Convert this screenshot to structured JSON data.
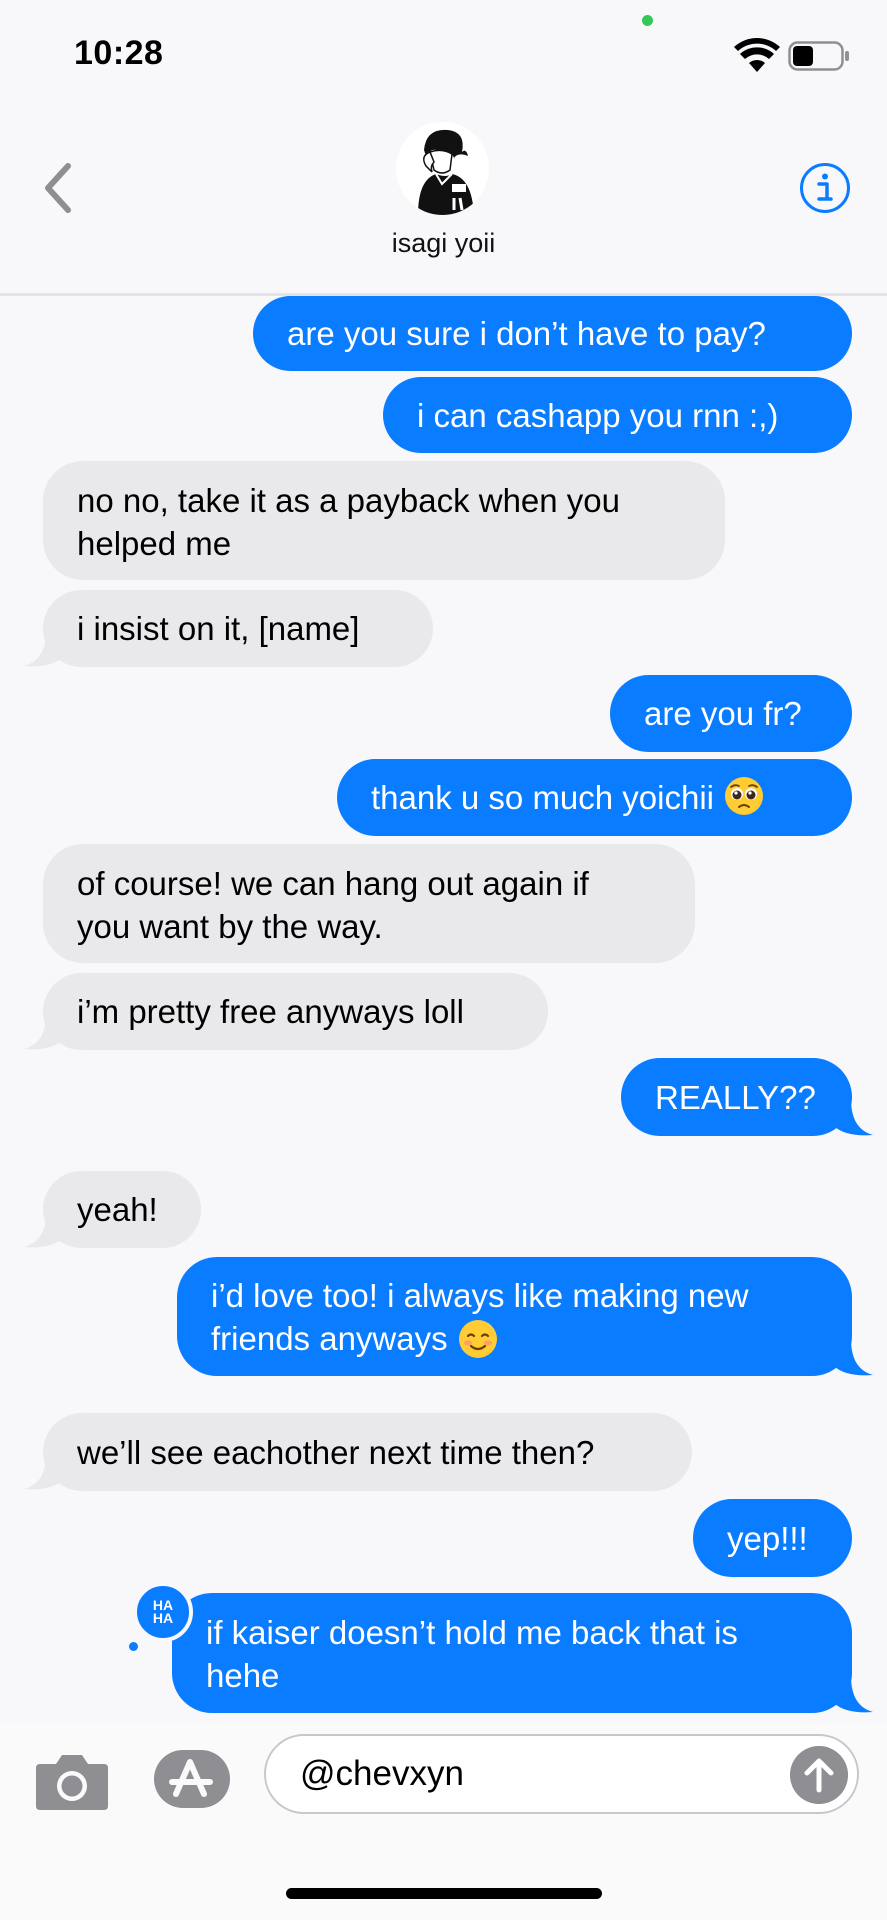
{
  "status_bar": {
    "time": "10:28",
    "battery_level_percent": 40
  },
  "header": {
    "contact_name": "isagi yoii",
    "back_icon": "chevron-left-icon",
    "info_icon": "info-icon",
    "accent_color": "#0a7cff"
  },
  "messages": [
    {
      "dir": "sent",
      "text": "are you sure i don’t have to pay?"
    },
    {
      "dir": "sent",
      "text": "i can cashapp you rnn :,)"
    },
    {
      "dir": "received",
      "text": "no no, take it as a payback when you\nhelped me"
    },
    {
      "dir": "received",
      "text": "i insist on it, [name]"
    },
    {
      "dir": "sent",
      "text": "are you fr?"
    },
    {
      "dir": "sent",
      "text": "thank u so much yoichii",
      "emoji": "pleading-face"
    },
    {
      "dir": "received",
      "text": "of course! we can hang out again if\nyou want by the way."
    },
    {
      "dir": "received",
      "text": "i’m pretty free anyways loll"
    },
    {
      "dir": "sent",
      "text": "REALLY??"
    },
    {
      "dir": "received",
      "text": "yeah!"
    },
    {
      "dir": "sent",
      "text": "i’d love too! i always like making new\nfriends anyways",
      "emoji": "smiling-face"
    },
    {
      "dir": "received",
      "text": "we’ll see eachother next time then?"
    },
    {
      "dir": "sent",
      "text": "yep!!!"
    },
    {
      "dir": "sent",
      "text": "if kaiser doesn’t hold me back that is\nhehe",
      "tapback": "HA HA"
    }
  ],
  "tapback_label": {
    "line1": "HA",
    "line2": "HA"
  },
  "input": {
    "value": "@chevxyn",
    "camera_icon": "camera-icon",
    "apps_icon": "app-store-icon",
    "send_icon": "arrow-up-icon"
  },
  "colors": {
    "sent_bubble": "#0a7cff",
    "received_bubble": "#e9e9ec",
    "background": "#f8f8fa"
  }
}
